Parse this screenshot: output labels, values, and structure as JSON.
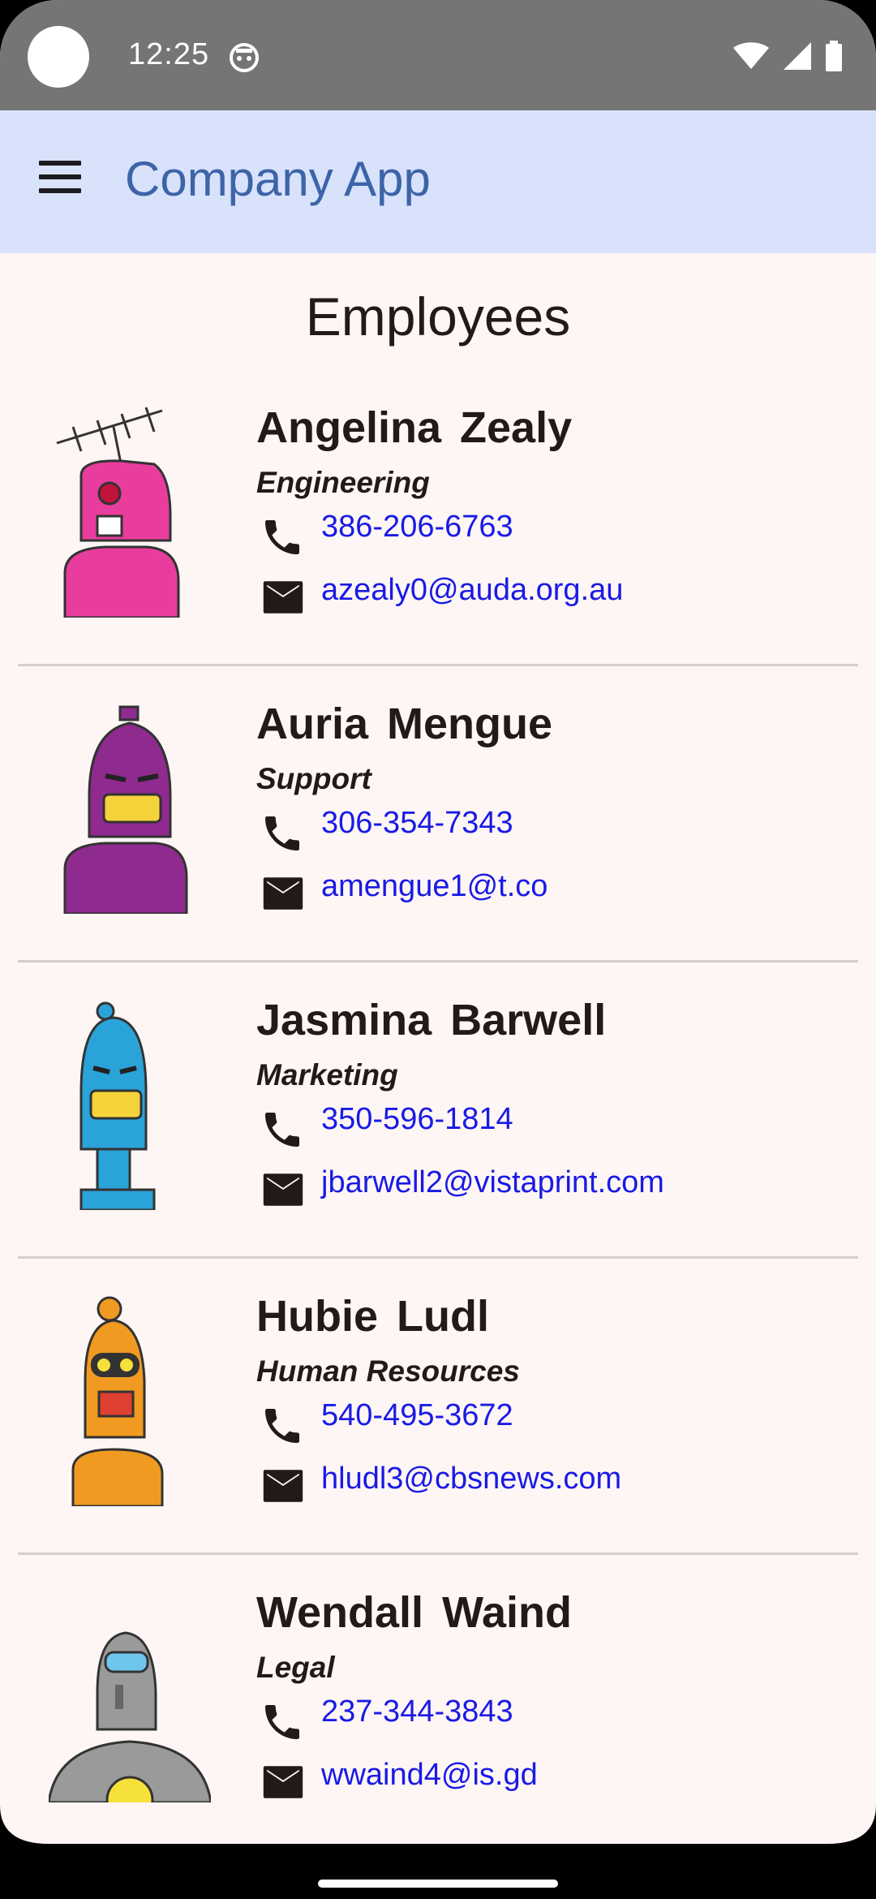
{
  "status_bar": {
    "time": "12:25",
    "icons": [
      "notification-icon",
      "wifi-icon",
      "signal-icon",
      "battery-icon"
    ]
  },
  "app_bar": {
    "title": "Company App",
    "menu_icon": "menu-icon"
  },
  "page": {
    "title": "Employees"
  },
  "employees": [
    {
      "name": "Angelina  Zealy",
      "department": "Engineering",
      "phone": "386-206-6763",
      "email": "azealy0@auda.org.au",
      "avatar_color": "#e93d9e"
    },
    {
      "name": "Auria  Mengue",
      "department": "Support",
      "phone": "306-354-7343",
      "email": "amengue1@t.co",
      "avatar_color": "#8f2a8f"
    },
    {
      "name": "Jasmina  Barwell",
      "department": "Marketing",
      "phone": "350-596-1814",
      "email": "jbarwell2@vistaprint.com",
      "avatar_color": "#2aa3d9"
    },
    {
      "name": "Hubie  Ludl",
      "department": "Human Resources",
      "phone": "540-495-3672",
      "email": "hludl3@cbsnews.com",
      "avatar_color": "#f19a22"
    },
    {
      "name": "Wendall  Waind",
      "department": "Legal",
      "phone": "237-344-3843",
      "email": "wwaind4@is.gd",
      "avatar_color": "#9a9a9a"
    }
  ],
  "colors": {
    "status_bar": "#757575",
    "app_bar": "#d8e2fb",
    "app_title": "#3d64a8",
    "link": "#1a1ae6",
    "background": "#fdf6f4"
  }
}
